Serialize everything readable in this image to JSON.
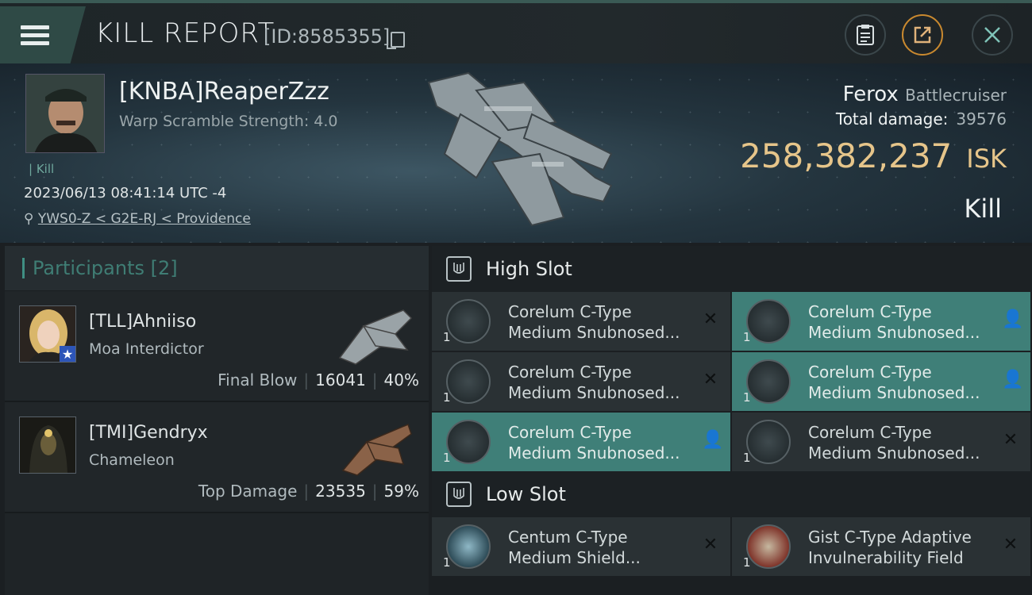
{
  "header": {
    "title": "KILL REPORT",
    "report_id": "[ID:8585355]"
  },
  "victim": {
    "name": "[KNBA]ReaperZzz",
    "warp_scramble": "Warp Scramble Strength: 4.0",
    "kill_tag": "Kill",
    "datetime": "2023/06/13 08:41:14 UTC -4",
    "location": "YWS0-Z < G2E-RJ < Providence",
    "ship": "Ferox",
    "ship_class": "Battlecruiser",
    "total_damage_label": "Total damage:",
    "total_damage": "39576",
    "isk_value": "258,382,237",
    "isk_unit": "ISK",
    "result": "Kill"
  },
  "participants": {
    "title": "Participants",
    "count": "[2]",
    "items": [
      {
        "name": "[TLL]Ahniiso",
        "ship": "Moa Interdictor",
        "role": "Final Blow",
        "damage": "16041",
        "percent": "40%"
      },
      {
        "name": "[TMI]Gendryx",
        "ship": "Chameleon",
        "role": "Top Damage",
        "damage": "23535",
        "percent": "59%"
      }
    ]
  },
  "high_slot": {
    "title": "High Slot",
    "items": [
      {
        "line1": "Corelum C-Type",
        "line2": "Medium Snubnosed...",
        "qty": "1",
        "state": "destroyed"
      },
      {
        "line1": "Corelum C-Type",
        "line2": "Medium Snubnosed...",
        "qty": "1",
        "state": "dropped"
      },
      {
        "line1": "Corelum C-Type",
        "line2": "Medium Snubnosed...",
        "qty": "1",
        "state": "destroyed"
      },
      {
        "line1": "Corelum C-Type",
        "line2": "Medium Snubnosed...",
        "qty": "1",
        "state": "dropped"
      },
      {
        "line1": "Corelum C-Type",
        "line2": "Medium Snubnosed...",
        "qty": "1",
        "state": "dropped"
      },
      {
        "line1": "Corelum C-Type",
        "line2": "Medium Snubnosed...",
        "qty": "1",
        "state": "destroyed"
      }
    ]
  },
  "low_slot": {
    "title": "Low Slot",
    "items": [
      {
        "line1": "Centum C-Type",
        "line2": "Medium Shield...",
        "qty": "1",
        "state": "destroyed"
      },
      {
        "line1": "Gist C-Type Adaptive",
        "line2": "Invulnerability Field",
        "qty": "1",
        "state": "destroyed"
      }
    ]
  },
  "icons": {
    "menu": "hamburger-icon",
    "copy": "copy-icon",
    "clipboard": "clipboard-icon",
    "share": "share-icon",
    "close": "close-icon",
    "location": "location-pin-icon",
    "destroyed": "x-icon",
    "dropped": "person-icon"
  },
  "colors": {
    "accent": "#3f7f78",
    "isk": "#e6c58a",
    "share_ring": "#c9892f"
  }
}
